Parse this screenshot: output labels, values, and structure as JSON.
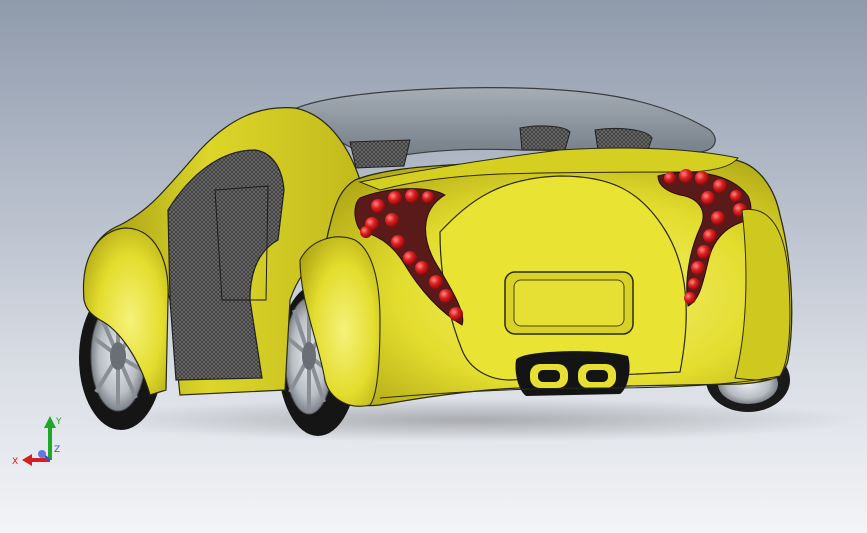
{
  "viewport": {
    "background_top": "#8f9aab",
    "background_bottom": "#f3f4f7"
  },
  "model": {
    "body_color": "#e6e13a",
    "light_color": "#e01f1f",
    "glass_color": "#8d96a0"
  },
  "triad": {
    "x_label": "X",
    "y_label": "Y",
    "z_label": "Z",
    "x_color": "#d42020",
    "y_color": "#1fa72a",
    "z_color": "#3a4fd4"
  }
}
